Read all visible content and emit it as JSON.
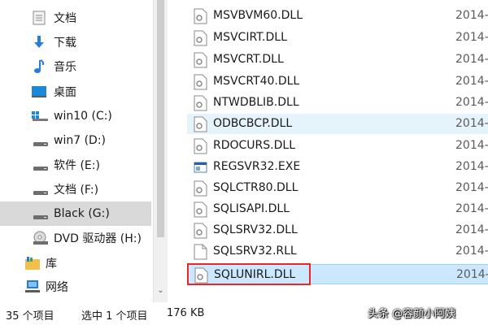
{
  "nav": {
    "items": [
      {
        "label": "文档",
        "icon": "documents-icon"
      },
      {
        "label": "下载",
        "icon": "download-icon"
      },
      {
        "label": "音乐",
        "icon": "music-icon"
      },
      {
        "label": "桌面",
        "icon": "desktop-icon"
      },
      {
        "label": "win10 (C:)",
        "icon": "windows-drive-icon"
      },
      {
        "label": "win7 (D:)",
        "icon": "drive-icon"
      },
      {
        "label": "软件 (E:)",
        "icon": "drive-icon"
      },
      {
        "label": "文档 (F:)",
        "icon": "drive-icon"
      },
      {
        "label": "Black (G:)",
        "icon": "drive-icon",
        "selected": true
      },
      {
        "label": "DVD 驱动器 (H:)",
        "icon": "dvd-drive-icon"
      },
      {
        "label": "库",
        "icon": "libraries-icon"
      },
      {
        "label": "网络",
        "icon": "network-icon"
      }
    ]
  },
  "files": {
    "rows": [
      {
        "name": "MSVBVM60.DLL",
        "date": "2014-",
        "icon": "dll-file-icon"
      },
      {
        "name": "MSVCIRT.DLL",
        "date": "2014-",
        "icon": "dll-file-icon"
      },
      {
        "name": "MSVCRT.DLL",
        "date": "2014-",
        "icon": "dll-file-icon"
      },
      {
        "name": "MSVCRT40.DLL",
        "date": "2014-",
        "icon": "dll-file-icon"
      },
      {
        "name": "NTWDBLIB.DLL",
        "date": "2014-",
        "icon": "dll-file-icon"
      },
      {
        "name": "ODBCBCP.DLL",
        "date": "2014-",
        "icon": "dll-file-icon",
        "state": "hover"
      },
      {
        "name": "RDOCURS.DLL",
        "date": "2014-",
        "icon": "dll-file-icon"
      },
      {
        "name": "REGSVR32.EXE",
        "date": "2014-",
        "icon": "exe-file-icon"
      },
      {
        "name": "SQLCTR80.DLL",
        "date": "2014-",
        "icon": "dll-file-icon"
      },
      {
        "name": "SQLISAPI.DLL",
        "date": "2014-",
        "icon": "dll-file-icon"
      },
      {
        "name": "SQLSRV32.DLL",
        "date": "2014-",
        "icon": "dll-file-icon"
      },
      {
        "name": "SQLSRV32.RLL",
        "date": "2014-",
        "icon": "blank-file-icon"
      },
      {
        "name": "SQLUNIRL.DLL",
        "date": "2014-",
        "icon": "dll-file-icon",
        "state": "selected"
      }
    ]
  },
  "status": {
    "item_count": "35 个项目",
    "selection": "选中 1 个项目",
    "size": "176 KB"
  },
  "watermark": "头条 @容颜小阿姨",
  "colors": {
    "selection_bg": "#cce8ff",
    "selection_border": "#99d1ff",
    "hover_bg": "#e5f3fb",
    "highlight_box": "#e32a2a",
    "nav_selected_bg": "#d9d9d9"
  }
}
